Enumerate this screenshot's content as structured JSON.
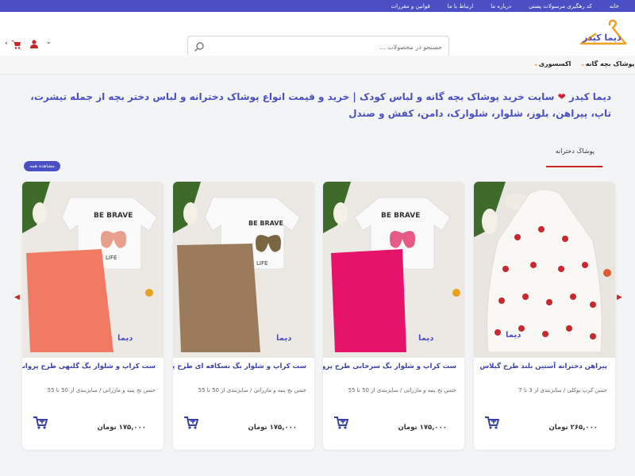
{
  "topbar": {
    "links": [
      "خانه",
      "کد رهگیری مرسولات پستی",
      "درباره ما",
      "ارتباط با ما",
      "قوانین و مقررات"
    ]
  },
  "header": {
    "logo_text": "دیما کیدز",
    "search_placeholder": "جستجو در محصولات ...",
    "icons": [
      "chevron-down-icon",
      "user-icon",
      "cart-icon",
      "chevron-left-icon"
    ]
  },
  "nav": {
    "items": [
      "پوشاک بچه گانه",
      "اکسسوری"
    ]
  },
  "headline": {
    "brand": "دیما کیدز",
    "text": "سایت خرید پوشاک بچه گانه و لباس کودک | خرید و قیمت انواع پوشاک دخترانه و لباس دختر بچه از جمله تیشرت، تاپ، پیراهن، بلوز، شلوار، شلوارک، دامن، کفش و صندل"
  },
  "section": {
    "tab": "پوشاک دخترانه",
    "see_all": "مشاهده همه"
  },
  "products": [
    {
      "name": "پیراهن دخترانه آستین بلند طرح گیلاس",
      "desc": "جنس کرپ بوکلی / سایزبندی از 3 تا 7",
      "price": "۲۶۵,۰۰۰",
      "currency": "تومان",
      "image": "white-cherry-dress"
    },
    {
      "name": "ست کراپ و شلوار بگ سرخابی طرح پروانه",
      "desc": "جنس نخ پنبه و مازراتی / سایزبندی از 50 تا 55",
      "price": "۱۷۵,۰۰۰",
      "currency": "تومان",
      "image": "crop-top-magenta-pants"
    },
    {
      "name": "ست کراپ و شلوار بگ نسکافه ای طرح پروانه",
      "desc": "جنس نخ پنبه و مازراتی / سایزبندی از 50 تا 55",
      "price": "۱۷۵,۰۰۰",
      "currency": "تومان",
      "image": "crop-top-brown-pants"
    },
    {
      "name": "ست کراپ و شلوار بگ گلبهی طرح پروانه",
      "desc": "جنس نخ پنبه و مازراتی / سایزبندی از 50 تا 55",
      "price": "۱۷۵,۰۰۰",
      "currency": "تومان",
      "image": "crop-top-coral-pants"
    }
  ],
  "colors": {
    "accent": "#4a4fc4",
    "brand_red": "#c62828",
    "logo_orange": "#f0a020"
  }
}
